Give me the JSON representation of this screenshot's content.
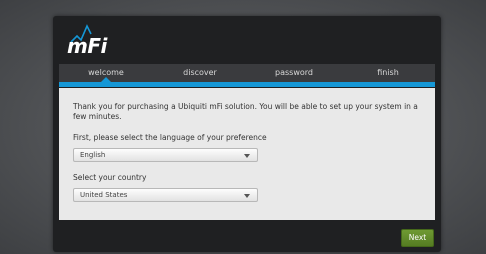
{
  "app": {
    "logo_text": "mFi"
  },
  "tabs": [
    {
      "label": "welcome",
      "active": true
    },
    {
      "label": "discover",
      "active": false
    },
    {
      "label": "password",
      "active": false
    },
    {
      "label": "finish",
      "active": false
    }
  ],
  "welcome": {
    "intro": "Thank you for purchasing a Ubiquiti mFi solution. You will be able to set up your system in a few minutes.",
    "language_label": "First, please select the language of your preference",
    "language_value": "English",
    "country_label": "Select your country",
    "country_value": "United States"
  },
  "footer": {
    "next_label": "Next"
  },
  "colors": {
    "accent": "#1597d6",
    "next_button": "#5f8a2a"
  },
  "icons": {
    "logo": "mfi-logo-icon",
    "dropdown": "chevron-down-icon"
  }
}
